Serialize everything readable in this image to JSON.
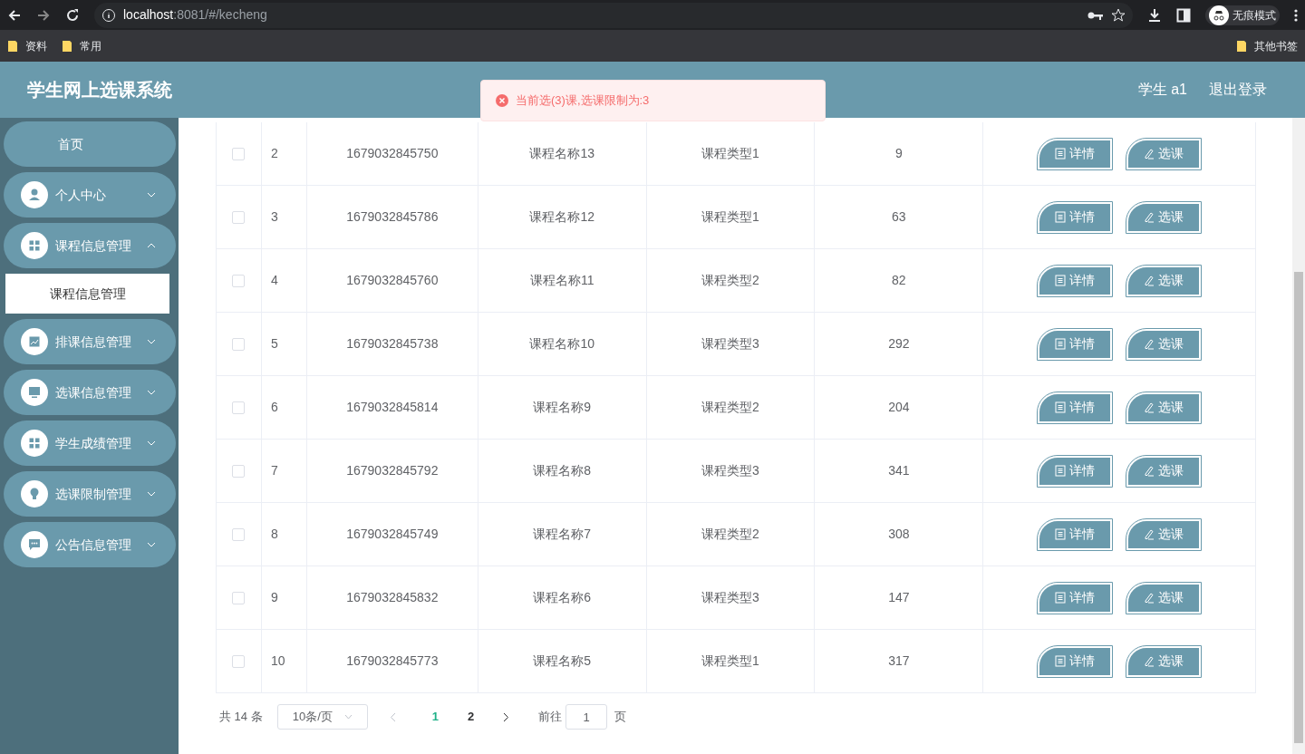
{
  "browser": {
    "url_host": "localhost",
    "url_rest": ":8081/#/kecheng",
    "profile_label": "无痕模式",
    "bookmarks": [
      "资料",
      "常用"
    ],
    "other_bookmarks": "其他书签"
  },
  "header": {
    "title": "学生网上选课系统",
    "user": "学生 a1",
    "logout": "退出登录"
  },
  "toast": {
    "message": "当前选(3)课,选课限制为:3"
  },
  "sidebar": {
    "items": [
      {
        "label": "首页",
        "kind": "plain",
        "expanded": false
      },
      {
        "label": "个人中心",
        "kind": "user",
        "expanded": false
      },
      {
        "label": "课程信息管理",
        "kind": "grid",
        "expanded": true,
        "children": [
          {
            "label": "课程信息管理",
            "selected": true
          }
        ]
      },
      {
        "label": "排课信息管理",
        "kind": "chart",
        "expanded": false
      },
      {
        "label": "选课信息管理",
        "kind": "monitor",
        "expanded": false
      },
      {
        "label": "学生成绩管理",
        "kind": "grid",
        "expanded": false
      },
      {
        "label": "选课限制管理",
        "kind": "bulb",
        "expanded": false
      },
      {
        "label": "公告信息管理",
        "kind": "chat",
        "expanded": false
      }
    ]
  },
  "table": {
    "rows": [
      {
        "checked": false,
        "cells": [
          "2",
          "1679032845750",
          "课程名称13",
          "课程类型1",
          "9"
        ],
        "actions": [
          {
            "label": "详情",
            "kind": "detail"
          },
          {
            "label": "选课",
            "kind": "select"
          }
        ]
      },
      {
        "checked": false,
        "cells": [
          "3",
          "1679032845786",
          "课程名称12",
          "课程类型1",
          "63"
        ],
        "actions": [
          {
            "label": "详情",
            "kind": "detail"
          },
          {
            "label": "选课",
            "kind": "select"
          }
        ]
      },
      {
        "checked": false,
        "cells": [
          "4",
          "1679032845760",
          "课程名称11",
          "课程类型2",
          "82"
        ],
        "actions": [
          {
            "label": "详情",
            "kind": "detail"
          },
          {
            "label": "选课",
            "kind": "select"
          }
        ]
      },
      {
        "checked": false,
        "cells": [
          "5",
          "1679032845738",
          "课程名称10",
          "课程类型3",
          "292"
        ],
        "actions": [
          {
            "label": "详情",
            "kind": "detail"
          },
          {
            "label": "选课",
            "kind": "select"
          }
        ]
      },
      {
        "checked": false,
        "cells": [
          "6",
          "1679032845814",
          "课程名称9",
          "课程类型2",
          "204"
        ],
        "actions": [
          {
            "label": "详情",
            "kind": "detail"
          },
          {
            "label": "选课",
            "kind": "select"
          }
        ]
      },
      {
        "checked": false,
        "cells": [
          "7",
          "1679032845792",
          "课程名称8",
          "课程类型3",
          "341"
        ],
        "actions": [
          {
            "label": "详情",
            "kind": "detail"
          },
          {
            "label": "选课",
            "kind": "select"
          }
        ]
      },
      {
        "checked": false,
        "cells": [
          "8",
          "1679032845749",
          "课程名称7",
          "课程类型2",
          "308"
        ],
        "actions": [
          {
            "label": "详情",
            "kind": "detail"
          },
          {
            "label": "选课",
            "kind": "select"
          }
        ]
      },
      {
        "checked": false,
        "cells": [
          "9",
          "1679032845832",
          "课程名称6",
          "课程类型3",
          "147"
        ],
        "actions": [
          {
            "label": "详情",
            "kind": "detail"
          },
          {
            "label": "选课",
            "kind": "select"
          }
        ]
      },
      {
        "checked": false,
        "cells": [
          "10",
          "1679032845773",
          "课程名称5",
          "课程类型1",
          "317"
        ],
        "actions": [
          {
            "label": "详情",
            "kind": "detail"
          },
          {
            "label": "选课",
            "kind": "select"
          }
        ]
      }
    ]
  },
  "pagination": {
    "total": "共 14 条",
    "page_size": "10条/页",
    "pages": [
      {
        "label": "1",
        "selected": true
      },
      {
        "label": "2",
        "selected": false
      }
    ],
    "goto_label": "前往",
    "goto_value": "1",
    "page_suffix": "页"
  }
}
